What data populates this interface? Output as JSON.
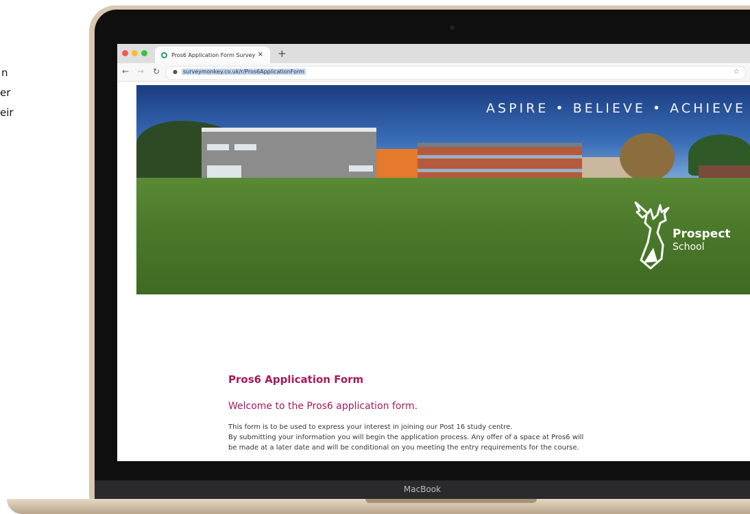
{
  "side_text": [
    "n",
    "er",
    "eir"
  ],
  "browser": {
    "tab_title": "Pros6 Application Form Survey",
    "tab_close": "×",
    "new_tab": "+",
    "url": "surveymonkey.co.uk/r/Pros6ApplicationForm"
  },
  "banner": {
    "motto": "ASPIRE • BELIEVE • ACHIEVE",
    "logo_name": "Prospect",
    "logo_sub": "School"
  },
  "form": {
    "title": "Pros6 Application Form",
    "welcome": "Welcome to the Pros6 application form.",
    "body": [
      "This form is to be used to express your interest in joining our Post 16 study centre.",
      "By submitting your information you will begin the application process. Any offer of a space at Pros6 will",
      "be made at a later date and will be conditional on you meeting the entry requirements for the course."
    ]
  },
  "device_label": "MacBook",
  "colors": {
    "accent": "#a3195b",
    "laptop_gold": "#d9c7b1"
  }
}
